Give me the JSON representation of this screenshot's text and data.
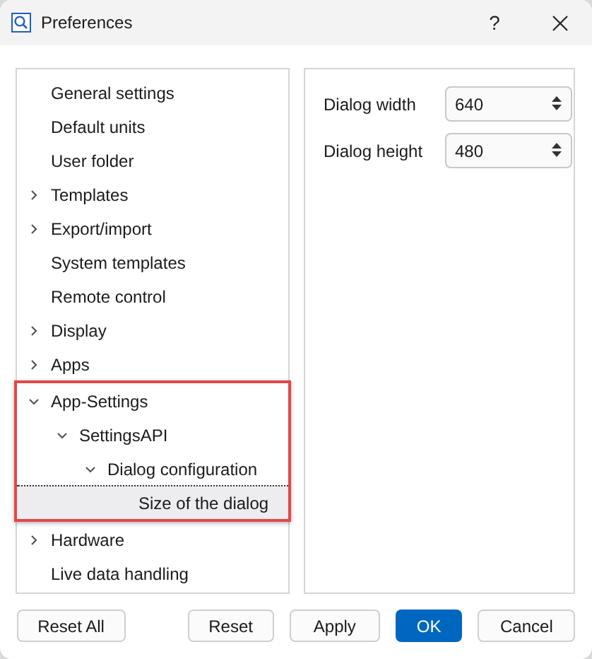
{
  "window": {
    "title": "Preferences",
    "help": "?"
  },
  "tree": [
    {
      "label": "General settings",
      "selected": false
    },
    {
      "label": "Default units",
      "selected": false
    },
    {
      "label": "User folder",
      "selected": false
    },
    {
      "label": "Templates",
      "selected": false,
      "expanded": false
    },
    {
      "label": "Export/import",
      "selected": false,
      "expanded": false
    },
    {
      "label": "System templates",
      "selected": false
    },
    {
      "label": "Remote control",
      "selected": false
    },
    {
      "label": "Display",
      "selected": false,
      "expanded": false
    },
    {
      "label": "Apps",
      "selected": false,
      "expanded": false
    },
    {
      "label": "App-Settings",
      "selected": false,
      "expanded": true,
      "highlighted": true,
      "children": [
        {
          "label": "SettingsAPI",
          "selected": false,
          "expanded": true,
          "children": [
            {
              "label": "Dialog configuration",
              "selected": false,
              "expanded": true,
              "children": [
                {
                  "label": "Size of the dialog",
                  "selected": true
                }
              ]
            }
          ]
        }
      ]
    },
    {
      "label": "Hardware",
      "selected": false,
      "expanded": false
    },
    {
      "label": "Live data handling",
      "selected": false
    }
  ],
  "fields": [
    {
      "label": "Dialog width",
      "value": "640"
    },
    {
      "label": "Dialog height",
      "value": "480"
    }
  ],
  "buttons": [
    {
      "label": "Reset All",
      "kind": "default"
    },
    {
      "label": "Reset",
      "kind": "default"
    },
    {
      "label": "Apply",
      "kind": "default"
    },
    {
      "label": "OK",
      "kind": "primary"
    },
    {
      "label": "Cancel",
      "kind": "default"
    }
  ]
}
